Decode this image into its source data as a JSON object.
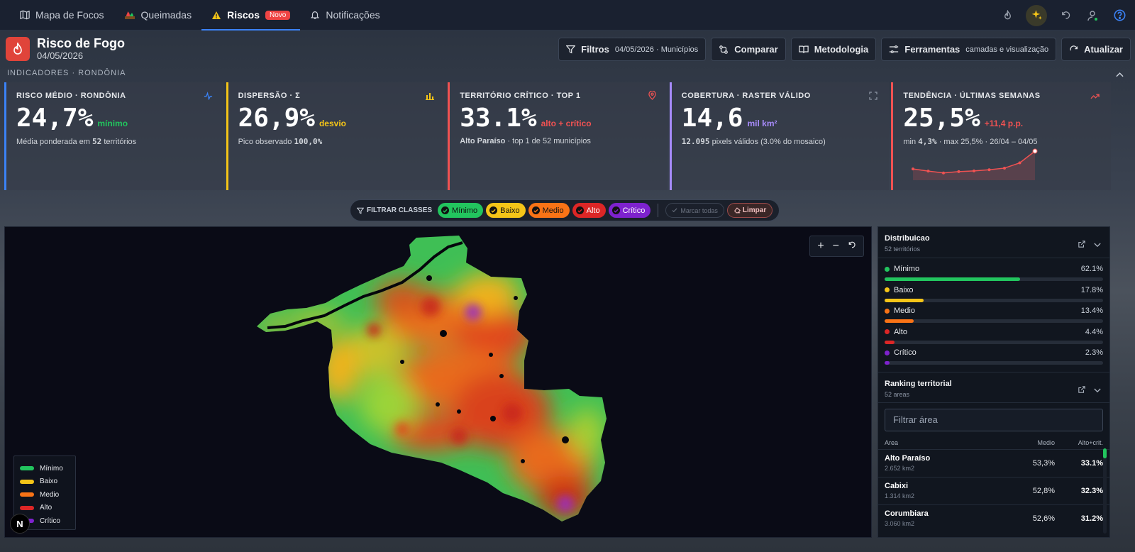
{
  "nav": {
    "tabs": [
      {
        "label": "Mapa de Focos",
        "icon": "map-icon"
      },
      {
        "label": "Queimadas",
        "icon": "burn-icon"
      },
      {
        "label": "Riscos",
        "icon": "warning-icon",
        "badge": "Novo"
      },
      {
        "label": "Notificações",
        "icon": "bell-icon"
      }
    ],
    "right_icons": [
      "flame-icon",
      "sparkles-icon",
      "refresh-icon",
      "user-icon",
      "help-icon"
    ]
  },
  "header": {
    "title": "Risco de Fogo",
    "date": "04/05/2026"
  },
  "toolbar": {
    "filters_label": "Filtros",
    "filters_value": "04/05/2026 · Municípios",
    "compare_label": "Comparar",
    "method_label": "Metodologia",
    "tools_label": "Ferramentas",
    "tools_sub": "camadas e visualização",
    "refresh_label": "Atualizar"
  },
  "section_label": "INDICADORES · RONDÔNIA",
  "kpis": [
    {
      "label": "RISCO MÉDIO · RONDÔNIA",
      "value": "24,7%",
      "unit": "mínimo",
      "note_pre": "Média ponderada em ",
      "note_bold": "52",
      "note_post": " territórios",
      "accent": "#3b82f6"
    },
    {
      "label": "DISPERSÃO · Σ",
      "value": "26,9%",
      "unit": "desvio",
      "note_pre": "Pico observado ",
      "note_bold": "100,0%",
      "note_post": "",
      "accent": "#f5c518"
    },
    {
      "label": "TERRITÓRIO CRÍTICO · TOP 1",
      "value": "33.1%",
      "unit": "alto + crítico",
      "note_pre": "Alto Paraíso",
      "note_bold": "",
      "note_post": " · top 1 de 52 municípios",
      "accent": "#f05252"
    },
    {
      "label": "COBERTURA · RASTER VÁLIDO",
      "value": "14,6",
      "unit": "mil km²",
      "note_pre": "",
      "note_bold": "12.095",
      "note_post": " pixels válidos (3.0% do mosaico)",
      "accent": "#a78bfa"
    },
    {
      "label": "TENDÊNCIA · ÚLTIMAS SEMANAS",
      "value": "25,5%",
      "unit": "+11,4 p.p.",
      "note_pre": "min ",
      "note_bold": "4,3%",
      "note_post": " · max 25,5% · 26/04 – 04/05",
      "accent": "#f05252"
    }
  ],
  "trend_series": [
    8.2,
    6.1,
    4.3,
    5.6,
    6.3,
    7.4,
    9.0,
    14.1,
    25.5
  ],
  "filter": {
    "label": "FILTRAR CLASSES",
    "classes": [
      {
        "label": "Mínimo",
        "color": "#22c55e"
      },
      {
        "label": "Baixo",
        "color": "#f5c518"
      },
      {
        "label": "Medio",
        "color": "#f97316"
      },
      {
        "label": "Alto",
        "color": "#dc2626"
      },
      {
        "label": "Crítico",
        "color": "#7e22ce"
      }
    ],
    "mark_all": "Marcar todas",
    "clear": "Limpar"
  },
  "map_legend": [
    {
      "label": "Mínimo",
      "color": "#22c55e"
    },
    {
      "label": "Baixo",
      "color": "#f5c518"
    },
    {
      "label": "Medio",
      "color": "#f97316"
    },
    {
      "label": "Alto",
      "color": "#dc2626"
    },
    {
      "label": "Crítico",
      "color": "#7e22ce"
    }
  ],
  "distribution": {
    "title": "Distribuicao",
    "subtitle": "52 territórios",
    "rows": [
      {
        "label": "Mínimo",
        "pct": "62.1%",
        "value": 62.1,
        "color": "#22c55e"
      },
      {
        "label": "Baixo",
        "pct": "17.8%",
        "value": 17.8,
        "color": "#f5c518"
      },
      {
        "label": "Medio",
        "pct": "13.4%",
        "value": 13.4,
        "color": "#f97316"
      },
      {
        "label": "Alto",
        "pct": "4.4%",
        "value": 4.4,
        "color": "#dc2626"
      },
      {
        "label": "Crítico",
        "pct": "2.3%",
        "value": 2.3,
        "color": "#7e22ce"
      }
    ]
  },
  "ranking": {
    "title": "Ranking territorial",
    "subtitle": "52 areas",
    "search_placeholder": "Filtrar área",
    "columns": [
      "Area",
      "Medio",
      "Alto+crit."
    ],
    "rows": [
      {
        "name": "Alto Paraíso",
        "area": "2.652 km2",
        "medio": "53,3%",
        "alto": "33.1%"
      },
      {
        "name": "Cabixi",
        "area": "1.314 km2",
        "medio": "52,8%",
        "alto": "32.3%"
      },
      {
        "name": "Corumbiara",
        "area": "3.060 km2",
        "medio": "52,6%",
        "alto": "31.2%"
      }
    ]
  }
}
